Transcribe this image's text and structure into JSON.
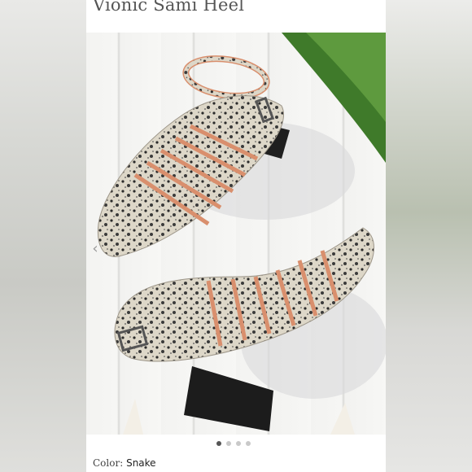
{
  "product": {
    "title": "Vionic Sami Heel",
    "color_label": "Color:",
    "color_value": "Snake"
  },
  "carousel": {
    "total_images": 4,
    "active_index": 0,
    "prev_arrow": "chevron-left-icon"
  },
  "colors": {
    "snake_base": "#ddd7c8",
    "snake_spot": "#2a2a2a",
    "heel": "#1f1f1f",
    "lining": "#d98f6d",
    "leaf": "#3f7a2a"
  }
}
